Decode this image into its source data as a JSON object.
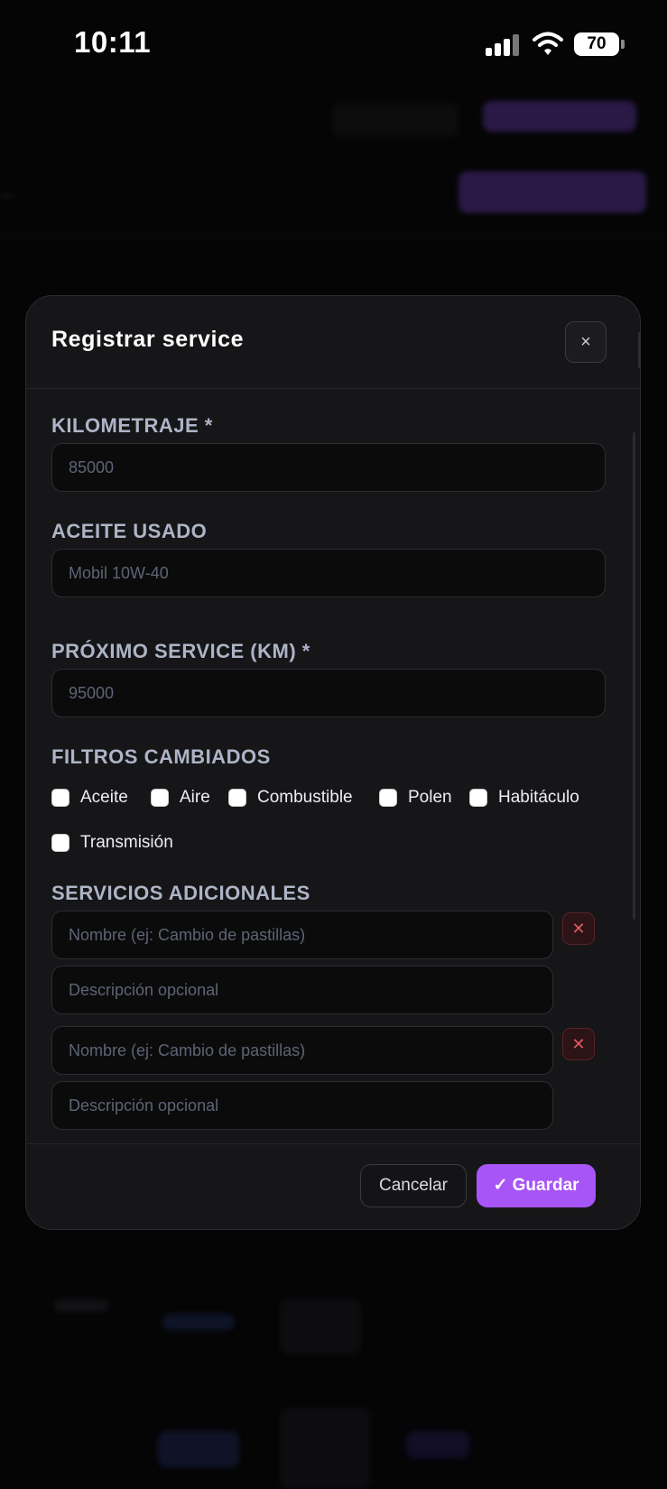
{
  "status_bar": {
    "time": "10:11",
    "battery": "70"
  },
  "modal": {
    "title": "Registrar service",
    "close_icon": "×",
    "kilometraje": {
      "label": "KILOMETRAJE *",
      "placeholder": "85000"
    },
    "aceite": {
      "label": "ACEITE USADO",
      "placeholder": "Mobil 10W-40"
    },
    "proximo": {
      "label": "PRÓXIMO SERVICE (KM) *",
      "placeholder": "95000"
    },
    "filtros": {
      "label": "FILTROS CAMBIADOS",
      "items": [
        "Aceite",
        "Aire",
        "Combustible",
        "Polen",
        "Habitáculo",
        "Transmisión"
      ]
    },
    "servicios": {
      "label": "SERVICIOS ADICIONALES",
      "items": [
        {
          "name_placeholder": "Nombre (ej: Cambio de pastillas)",
          "desc_placeholder": "Descripción opcional"
        },
        {
          "name_placeholder": "Nombre (ej: Cambio de pastillas)",
          "desc_placeholder": "Descripción opcional"
        }
      ],
      "remove_icon": "✕"
    },
    "cancel_label": "Cancelar",
    "save_label": "✓ Guardar"
  },
  "colors": {
    "accent": "#a855f7",
    "danger": "#e05a5f",
    "modal_bg": "#161618"
  }
}
